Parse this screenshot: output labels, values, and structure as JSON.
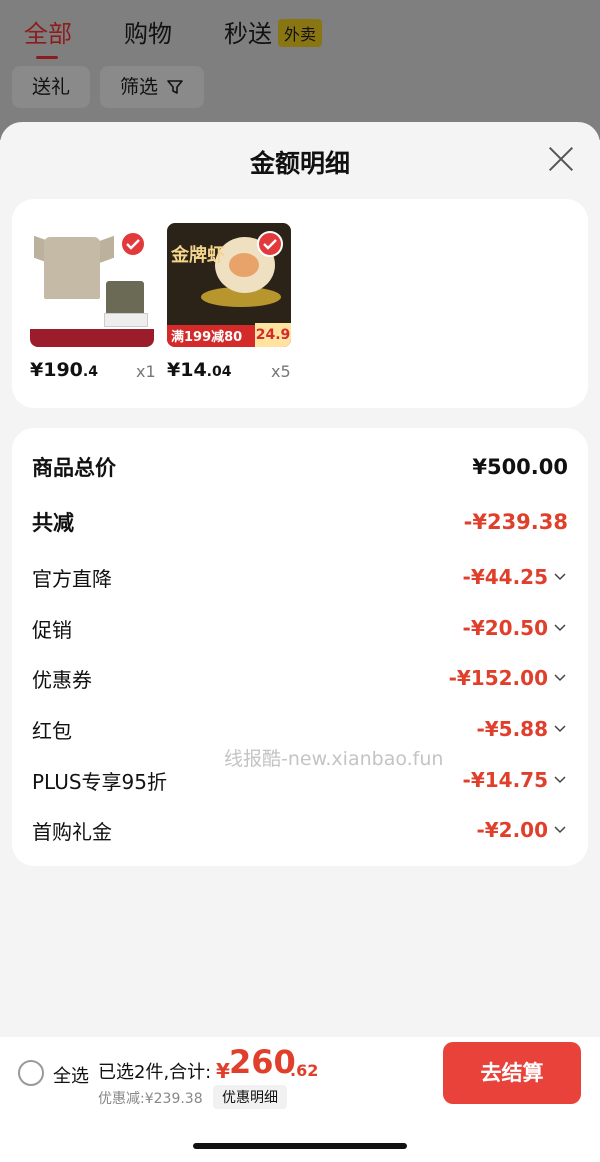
{
  "top_tabs": [
    {
      "label": "全部",
      "active": true
    },
    {
      "label": "购物",
      "active": false
    },
    {
      "label": "秒送",
      "active": false,
      "badge": "外卖"
    }
  ],
  "chips": [
    {
      "label": "送礼"
    },
    {
      "label": "筛选",
      "icon": "funnel-icon"
    }
  ],
  "sheet": {
    "title": "金额明细",
    "close_icon": "close-icon"
  },
  "products": [
    {
      "price_main": "¥190",
      "price_decimal": ".4",
      "quantity": "x1",
      "selected": true
    },
    {
      "price_main": "¥14",
      "price_decimal": ".04",
      "quantity": "x5",
      "selected": true,
      "image_text": {
        "title": "金牌虾",
        "promo": "满199减80",
        "promo_price": "24.9"
      }
    }
  ],
  "breakdown": {
    "total": {
      "label": "商品总价",
      "amount": "¥500.00"
    },
    "reduction": {
      "label": "共减",
      "amount": "-¥239.38"
    },
    "items": [
      {
        "label": "官方直降",
        "amount": "-¥44.25"
      },
      {
        "label": "促销",
        "amount": "-¥20.50"
      },
      {
        "label": "优惠券",
        "amount": "-¥152.00"
      },
      {
        "label": "红包",
        "amount": "-¥5.88"
      },
      {
        "label": "PLUS专享95折",
        "amount": "-¥14.75"
      },
      {
        "label": "首购礼金",
        "amount": "-¥2.00"
      }
    ]
  },
  "watermark": "线报酷-new.xianbao.fun",
  "bottom": {
    "select_all": "全选",
    "summary": "已选2件,合计:",
    "currency": "¥",
    "total_big": "260",
    "total_cents": ".62",
    "discount": "优惠减:¥239.38",
    "detail_link": "优惠明细",
    "checkout": "去结算"
  },
  "colors": {
    "accent": "#e0402b",
    "checkout_bg": "#e8423a",
    "check_badge": "#e23a3a"
  }
}
